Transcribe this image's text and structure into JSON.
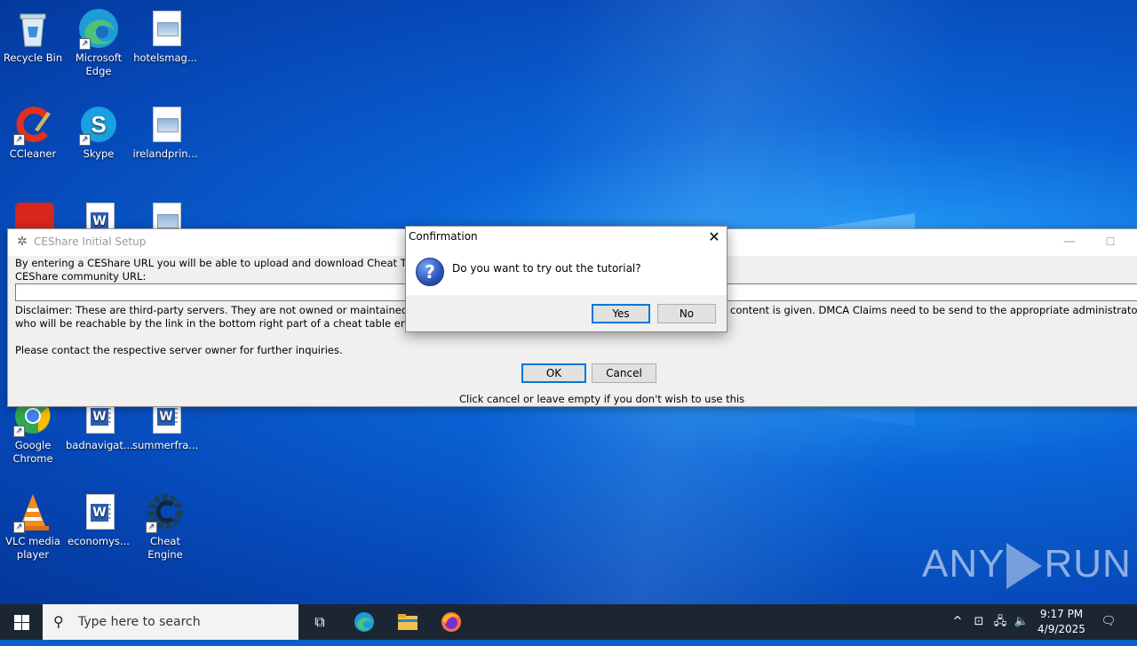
{
  "desktop": {
    "icons": [
      {
        "label": "Recycle Bin",
        "icon": "recycle-bin-icon"
      },
      {
        "label": "Microsoft Edge",
        "icon": "edge-icon"
      },
      {
        "label": "hotelsmag...",
        "icon": "image-file-icon"
      },
      {
        "label": "CCleaner",
        "icon": "ccleaner-icon"
      },
      {
        "label": "Skype",
        "icon": "skype-icon"
      },
      {
        "label": "irelandprin...",
        "icon": "image-file-icon"
      },
      {
        "label": "Google Chrome",
        "icon": "chrome-icon"
      },
      {
        "label": "badnavigat...",
        "icon": "word-doc-icon"
      },
      {
        "label": "summerfra...",
        "icon": "word-doc-icon"
      },
      {
        "label": "VLC media player",
        "icon": "vlc-icon"
      },
      {
        "label": "economys...",
        "icon": "word-doc-icon"
      },
      {
        "label": "Cheat Engine",
        "icon": "cheat-engine-icon"
      }
    ],
    "watermark": {
      "left": "ANY",
      "right": "RUN"
    }
  },
  "ceshare_window": {
    "title": "CEShare Initial Setup",
    "intro": "By entering a CEShare URL you will be able to upload and download Cheat Tables fro",
    "url_label": "CEShare community URL:",
    "url_value": "",
    "disclaimer_left": "Disclaimer: These are third-party servers. They are not owned or maintained by the C",
    "disclaimer_right": "content is given.  DMCA Claims need to be send to the appropriate administrator of the",
    "disclaimer_line2": "who will be reachable by the link in the bottom right part of a cheat table entry",
    "contact_text": "Please contact the respective server owner for further inquiries.",
    "ok_label": "OK",
    "cancel_label": "Cancel",
    "footer_text": "Click cancel or leave empty if you don't wish to use this",
    "minimize_glyph": "—",
    "maximize_glyph": "☐"
  },
  "confirmation_dialog": {
    "title": "Confirmation",
    "message": "Do you want to try out the tutorial?",
    "yes_label": "Yes",
    "no_label": "No",
    "close_glyph": "✕",
    "icon_glyph": "?"
  },
  "taskbar": {
    "search_placeholder": "Type here to search",
    "time": "9:17 PM",
    "date": "4/9/2025",
    "colors": {
      "background": "#1c2633",
      "accent": "#0078d7"
    }
  }
}
